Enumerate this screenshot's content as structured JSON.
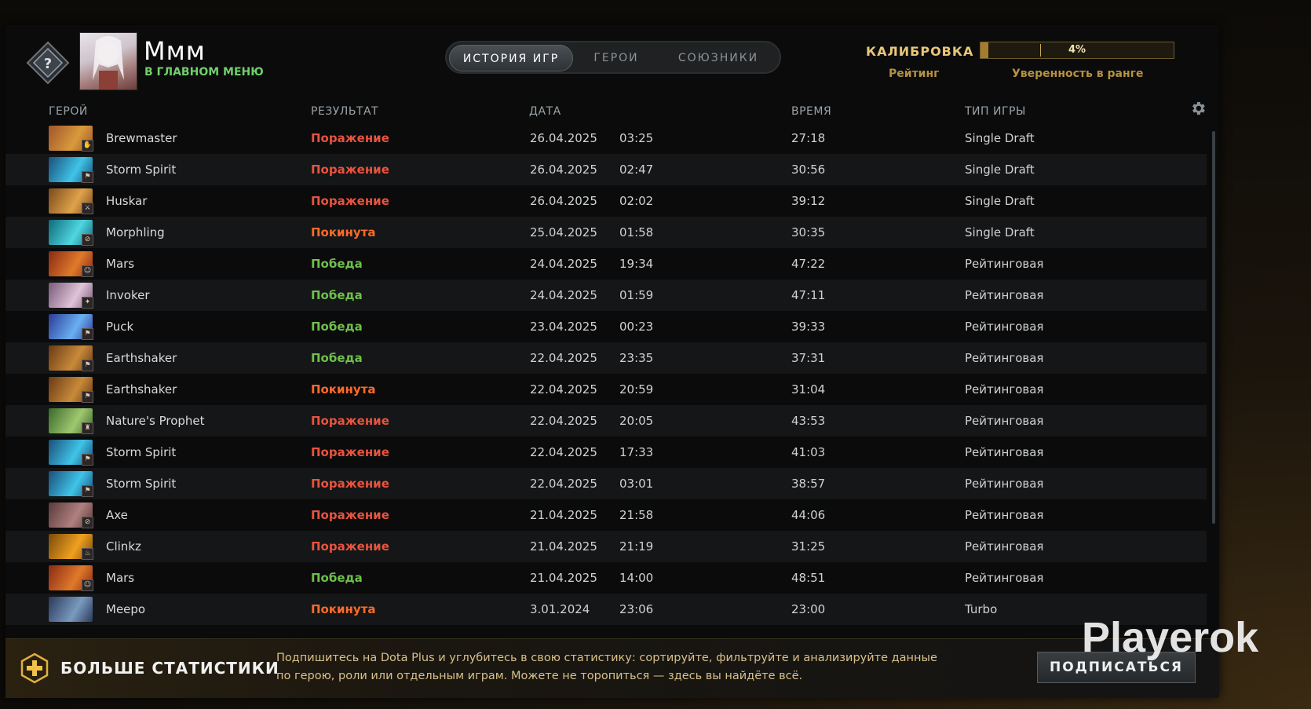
{
  "header": {
    "player_name": "Ммм",
    "player_status": "В ГЛАВНОМ МЕНЮ",
    "tabs": [
      {
        "label": "ИСТОРИЯ ИГР",
        "active": true
      },
      {
        "label": "ГЕРОИ",
        "active": false
      },
      {
        "label": "СОЮЗНИКИ",
        "active": false
      }
    ],
    "calibration_title": "КАЛИБРОВКА",
    "rating_label": "Рейтинг",
    "confidence_value": "4%",
    "confidence_fraction": 0.04,
    "confidence_label": "Уверенность в ранге"
  },
  "columns": {
    "hero": "ГЕРОЙ",
    "result": "РЕЗУЛЬТАТ",
    "date": "ДАТА",
    "duration": "ВРЕМЯ",
    "mode": "ТИП ИГРЫ"
  },
  "matches": [
    {
      "hero": "Brewmaster",
      "result": "Поражение",
      "status": "loss",
      "date": "26.04.2025",
      "time": "03:25",
      "duration": "27:18",
      "mode": "Single Draft",
      "pic": [
        "#a0552a",
        "#d99a3c"
      ],
      "role": "✋"
    },
    {
      "hero": "Storm Spirit",
      "result": "Поражение",
      "status": "loss",
      "date": "26.04.2025",
      "time": "02:47",
      "duration": "30:56",
      "mode": "Single Draft",
      "pic": [
        "#1a4f7a",
        "#3fc4e8"
      ],
      "role": "⚑"
    },
    {
      "hero": "Huskar",
      "result": "Поражение",
      "status": "loss",
      "date": "26.04.2025",
      "time": "02:02",
      "duration": "39:12",
      "mode": "Single Draft",
      "pic": [
        "#7a4a1c",
        "#e0a24a"
      ],
      "role": "⚔"
    },
    {
      "hero": "Morphling",
      "result": "Покинута",
      "status": "abandon",
      "date": "25.04.2025",
      "time": "01:58",
      "duration": "30:35",
      "mode": "Single Draft",
      "pic": [
        "#0f6a7a",
        "#4fd6e0"
      ],
      "role": "⊘"
    },
    {
      "hero": "Mars",
      "result": "Победа",
      "status": "win",
      "date": "24.04.2025",
      "time": "19:34",
      "duration": "47:22",
      "mode": "Рейтинговая",
      "pic": [
        "#8a2a14",
        "#e07a2a"
      ],
      "role": "☺"
    },
    {
      "hero": "Invoker",
      "result": "Победа",
      "status": "win",
      "date": "24.04.2025",
      "time": "01:59",
      "duration": "47:11",
      "mode": "Рейтинговая",
      "pic": [
        "#7a5a7a",
        "#e0c4d8"
      ],
      "role": "✦"
    },
    {
      "hero": "Puck",
      "result": "Победа",
      "status": "win",
      "date": "23.04.2025",
      "time": "00:23",
      "duration": "39:33",
      "mode": "Рейтинговая",
      "pic": [
        "#2a3a9a",
        "#6ab0f0"
      ],
      "role": "⚑"
    },
    {
      "hero": "Earthshaker",
      "result": "Победа",
      "status": "win",
      "date": "22.04.2025",
      "time": "23:35",
      "duration": "37:31",
      "mode": "Рейтинговая",
      "pic": [
        "#6a3a14",
        "#c88a3a"
      ],
      "role": "⚑"
    },
    {
      "hero": "Earthshaker",
      "result": "Покинута",
      "status": "abandon",
      "date": "22.04.2025",
      "time": "20:59",
      "duration": "31:04",
      "mode": "Рейтинговая",
      "pic": [
        "#6a3a14",
        "#c88a3a"
      ],
      "role": "⚑"
    },
    {
      "hero": "Nature's Prophet",
      "result": "Поражение",
      "status": "loss",
      "date": "22.04.2025",
      "time": "20:05",
      "duration": "43:53",
      "mode": "Рейтинговая",
      "pic": [
        "#3a6a2a",
        "#a0c870"
      ],
      "role": "♜"
    },
    {
      "hero": "Storm Spirit",
      "result": "Поражение",
      "status": "loss",
      "date": "22.04.2025",
      "time": "17:33",
      "duration": "41:03",
      "mode": "Рейтинговая",
      "pic": [
        "#1a4f7a",
        "#3fc4e8"
      ],
      "role": "⚑"
    },
    {
      "hero": "Storm Spirit",
      "result": "Поражение",
      "status": "loss",
      "date": "22.04.2025",
      "time": "03:01",
      "duration": "38:57",
      "mode": "Рейтинговая",
      "pic": [
        "#1a4f7a",
        "#3fc4e8"
      ],
      "role": "⚑"
    },
    {
      "hero": "Axe",
      "result": "Поражение",
      "status": "loss",
      "date": "21.04.2025",
      "time": "21:58",
      "duration": "44:06",
      "mode": "Рейтинговая",
      "pic": [
        "#5a3a3a",
        "#b08080"
      ],
      "role": "⊘"
    },
    {
      "hero": "Clinkz",
      "result": "Поражение",
      "status": "loss",
      "date": "21.04.2025",
      "time": "21:19",
      "duration": "31:25",
      "mode": "Рейтинговая",
      "pic": [
        "#7a4a0a",
        "#f0a020"
      ],
      "role": "♨"
    },
    {
      "hero": "Mars",
      "result": "Победа",
      "status": "win",
      "date": "21.04.2025",
      "time": "14:00",
      "duration": "48:51",
      "mode": "Рейтинговая",
      "pic": [
        "#8a2a14",
        "#e07a2a"
      ],
      "role": "☺"
    },
    {
      "hero": "Meepo",
      "result": "Покинута",
      "status": "abandon",
      "date": "3.01.2024",
      "time": "23:06",
      "duration": "23:00",
      "mode": "Turbo",
      "pic": [
        "#2a3a5a",
        "#7a9ac0"
      ],
      "role": ""
    }
  ],
  "footer": {
    "title": "БОЛЬШЕ СТАТИСТИКИ",
    "text": "Подпишитесь на Dota Plus и углубитесь в свою статистику: сортируйте, фильтруйте и анализируйте данные по герою, роли или отдельным играм. Можете не торопиться — здесь вы найдёте всё.",
    "button": "ПОДПИСАТЬСЯ"
  },
  "watermark": "Playerok",
  "colors": {
    "loss": "#e8533f",
    "win": "#6fbf4a",
    "abandon": "#ff6a2a",
    "accent_gold": "#e8c77a"
  }
}
